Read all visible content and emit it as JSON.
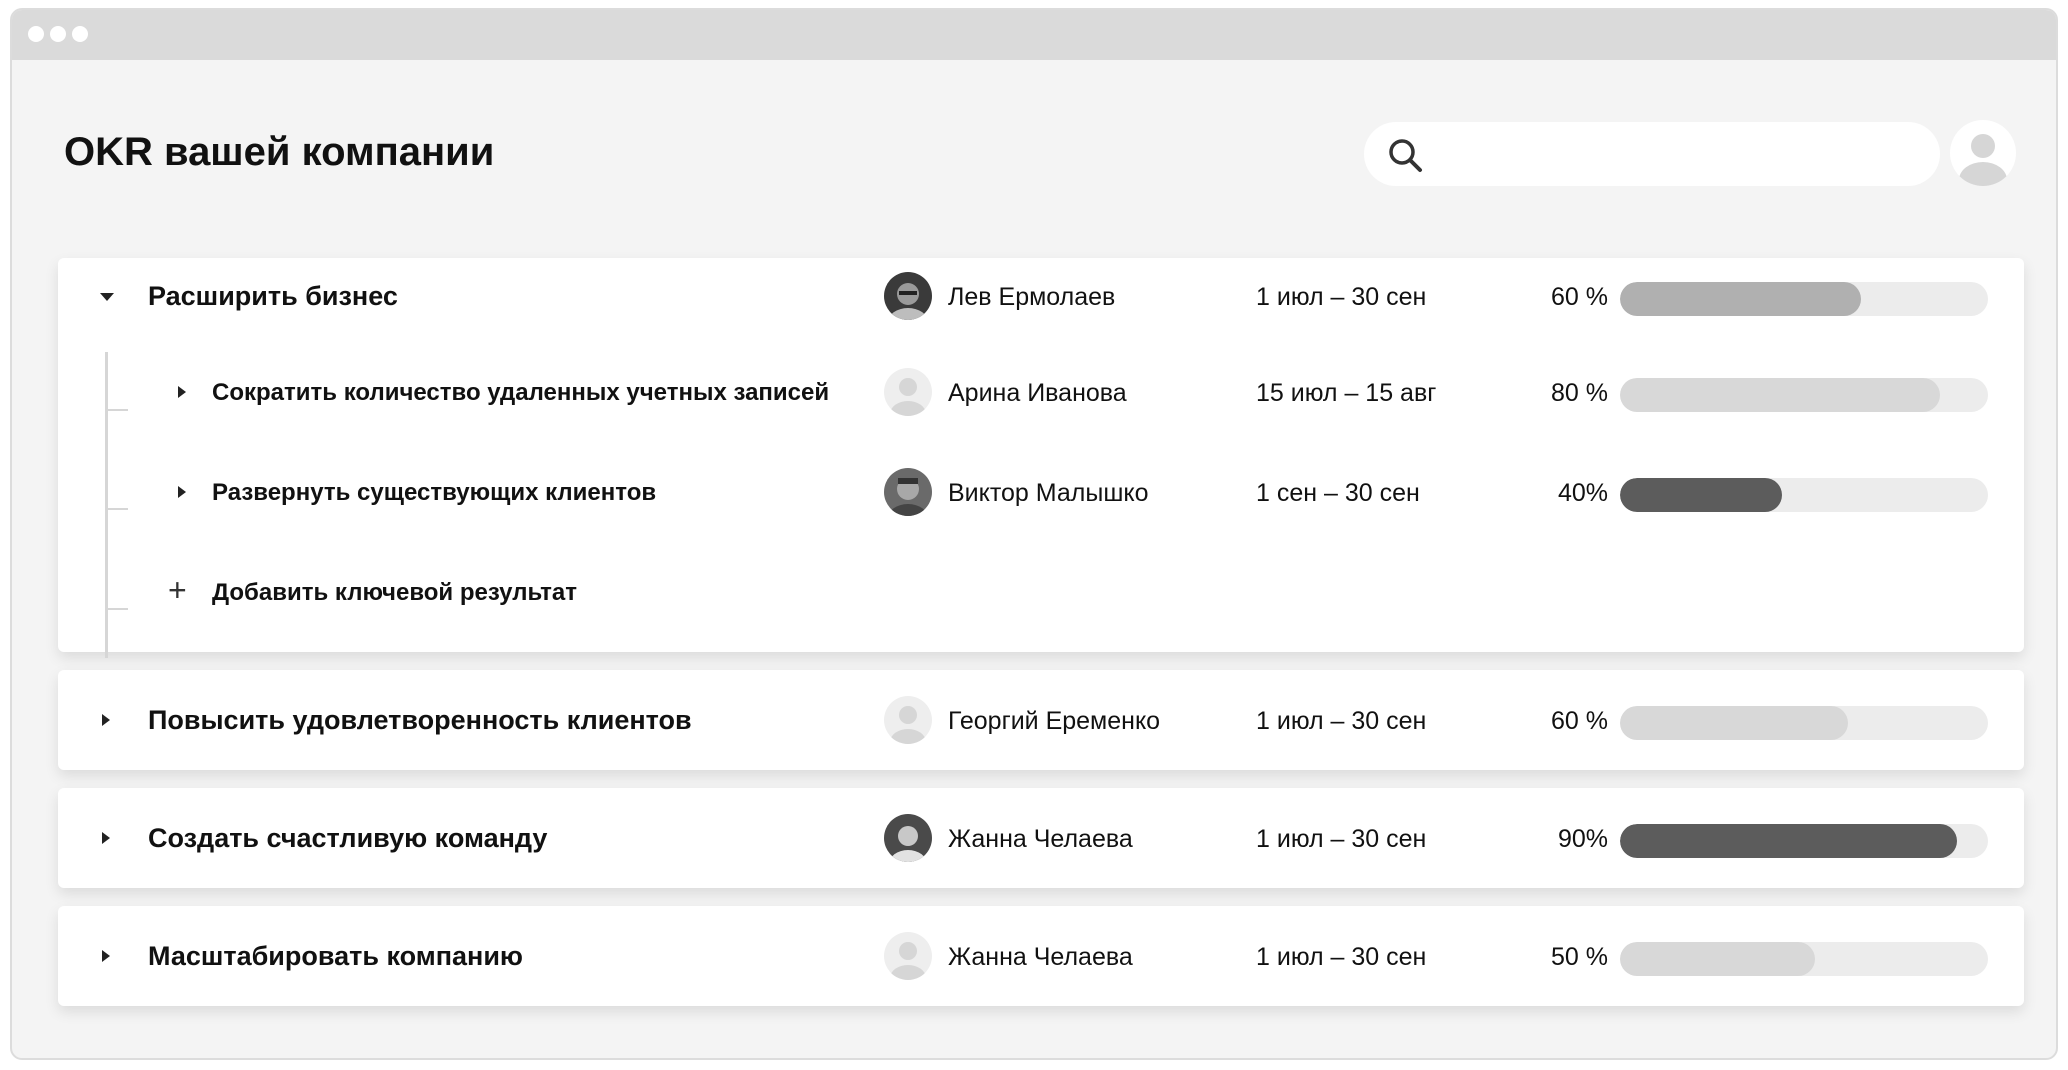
{
  "header": {
    "title": "OKR вашей компании",
    "search": {
      "placeholder": "",
      "icon": "search-icon"
    }
  },
  "objectives": [
    {
      "title": "Расширить бизнес",
      "owner": "Лев Ермолаев",
      "avatar": "photo",
      "dates": "1 июл – 30 сен",
      "progress_label": "60 %",
      "progress": 0.655,
      "bar_color": "#b0b0b0",
      "expanded": true,
      "key_results": [
        {
          "title": "Сократить количество удаленных учетных записей",
          "owner": "Арина Иванова",
          "avatar": "placeholder",
          "dates": "15 июл – 15 авг",
          "progress_label": "80 %",
          "progress": 0.87,
          "bar_color": "#d8d8d8"
        },
        {
          "title": "Развернуть существующих клиентов",
          "owner": "Виктор Малышко",
          "avatar": "photo",
          "dates": "1 сен – 30 сен",
          "progress_label": "40%",
          "progress": 0.44,
          "bar_color": "#5c5c5c"
        }
      ],
      "add_key_result_label": "Добавить ключевой результат"
    },
    {
      "title": "Повысить удовлетворенность клиентов",
      "owner": "Георгий Еременко",
      "avatar": "placeholder",
      "dates": "1 июл – 30 сен",
      "progress_label": "60 %",
      "progress": 0.62,
      "bar_color": "#d8d8d8",
      "expanded": false
    },
    {
      "title": "Создать счастливую команду",
      "owner": "Жанна Челаева",
      "avatar": "photo",
      "dates": "1 июл – 30 сен",
      "progress_label": "90%",
      "progress": 0.915,
      "bar_color": "#5c5c5c",
      "expanded": false
    },
    {
      "title": "Масштабировать компанию",
      "owner": "Жанна Челаева",
      "avatar": "placeholder",
      "dates": "1 июл – 30 сен",
      "progress_label": "50 %",
      "progress": 0.53,
      "bar_color": "#d8d8d8",
      "expanded": false
    }
  ]
}
